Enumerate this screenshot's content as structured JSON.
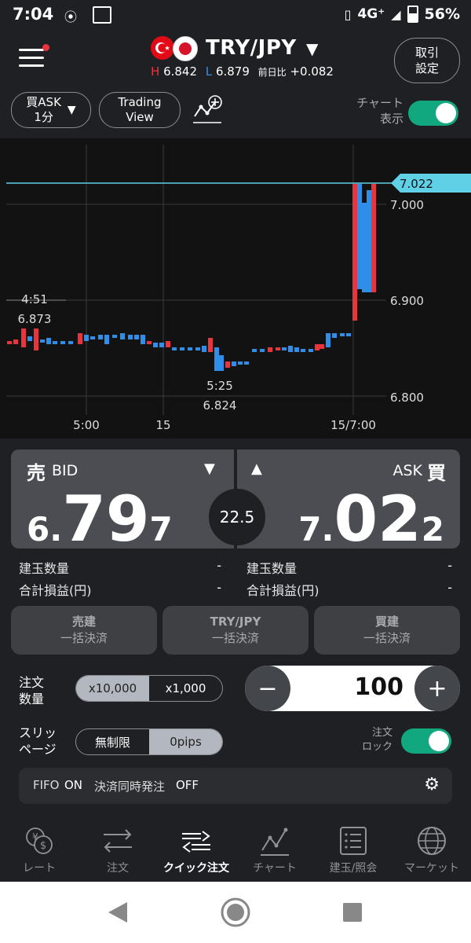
{
  "status_bar": {
    "time": "7:04",
    "network": "4G⁺",
    "battery": "56%"
  },
  "header": {
    "pair": "TRY/JPY",
    "high_label": "H",
    "high_value": "6.842",
    "low_label": "L",
    "low_value": "6.879",
    "change_label": "前日比",
    "change_value": "+0.082",
    "settings_line1": "取引",
    "settings_line2": "設定"
  },
  "toolbar": {
    "rate_line1": "買ASK",
    "rate_line2": "1分",
    "tv_line1": "Trading",
    "tv_line2": "View",
    "chart_toggle_line1": "チャート",
    "chart_toggle_line2": "表示"
  },
  "chart": {
    "current_price": "7.022",
    "y_ticks": [
      "7.000",
      "6.900",
      "6.800"
    ],
    "x_ticks": [
      "5:00",
      "15",
      "15/7:00"
    ],
    "high_annot_time": "4:51",
    "high_annot_price": "6.873",
    "low_annot_time": "5:25",
    "low_annot_price": "6.824",
    "colors": {
      "up": "#2e8ee8",
      "down": "#e8353d",
      "price_line": "#5fd0e6"
    }
  },
  "quote": {
    "bid_kanji": "売",
    "bid_label": "BID",
    "bid_small1": "6.",
    "bid_big": "79",
    "bid_small2": "7",
    "ask_label": "ASK",
    "ask_kanji": "買",
    "ask_small1": "7.",
    "ask_big": "02",
    "ask_small2": "2",
    "spread": "22.5"
  },
  "positions": {
    "left": [
      {
        "label": "建玉数量",
        "value": "-"
      },
      {
        "label": "合計損益(円)",
        "value": "-"
      }
    ],
    "right": [
      {
        "label": "建玉数量",
        "value": "-"
      },
      {
        "label": "合計損益(円)",
        "value": "-"
      }
    ]
  },
  "settle_buttons": [
    {
      "line1": "売建",
      "line2": "一括決済"
    },
    {
      "line1": "TRY/JPY",
      "line2": "一括決済"
    },
    {
      "line1": "買建",
      "line2": "一括決済"
    }
  ],
  "order": {
    "qty_label_1": "注文",
    "qty_label_2": "数量",
    "mult_a": "x10,000",
    "mult_b": "x1,000",
    "quantity": "100",
    "minus": "−",
    "plus": "+",
    "slip_label_1": "スリッ",
    "slip_label_2": "ページ",
    "slip_a": "無制限",
    "slip_b": "0pips",
    "lock_label_1": "注文",
    "lock_label_2": "ロック"
  },
  "fifo": {
    "fifo_label": "FIFO",
    "fifo_value": "ON",
    "simul_label": "決済同時発注",
    "simul_value": "OFF"
  },
  "nav": [
    {
      "label": "レート",
      "icon": "yen-dollar-icon"
    },
    {
      "label": "注文",
      "icon": "swap-arrows-icon"
    },
    {
      "label": "クイック注文",
      "icon": "quick-order-icon"
    },
    {
      "label": "チャート",
      "icon": "chart-icon"
    },
    {
      "label": "建玉/照会",
      "icon": "list-icon"
    },
    {
      "label": "マーケット",
      "icon": "globe-icon"
    }
  ]
}
